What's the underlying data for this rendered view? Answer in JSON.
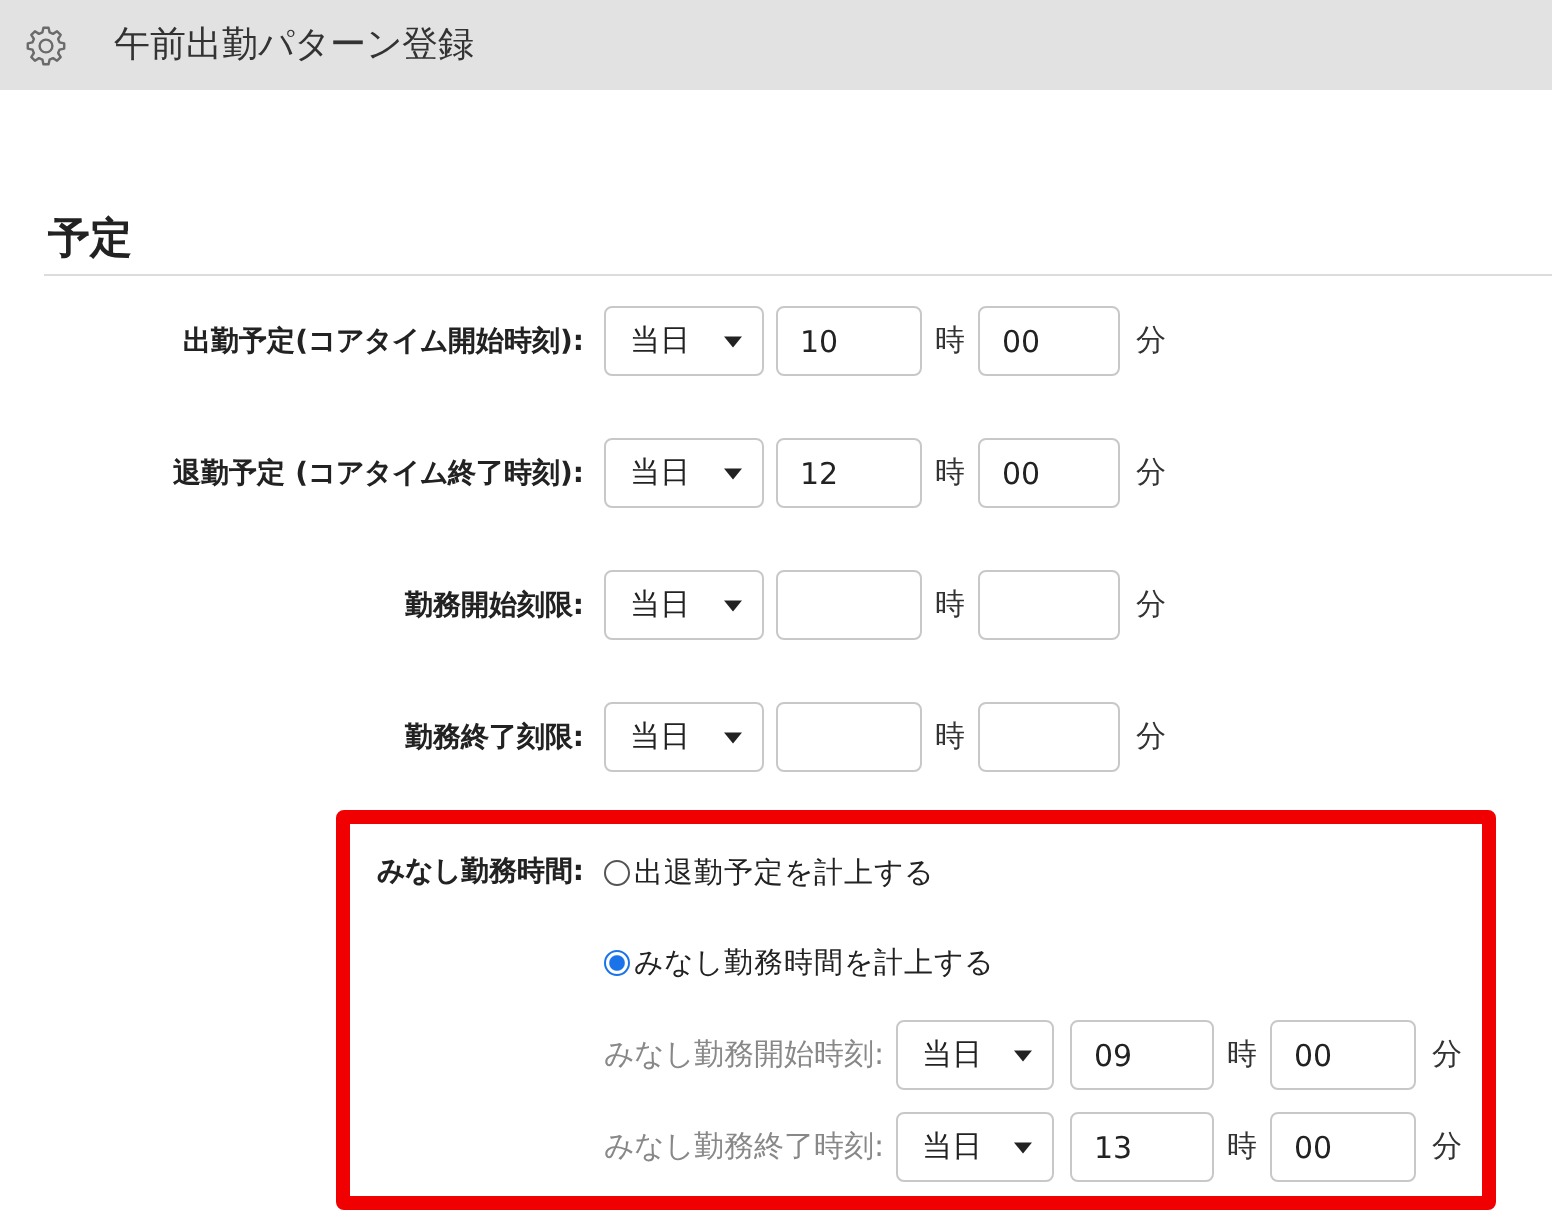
{
  "header": {
    "title": "午前出勤パターン登録"
  },
  "section": {
    "title": "予定"
  },
  "rows": [
    {
      "label": "出勤予定(コアタイム開始時刻):",
      "day": "当日",
      "hour": "10",
      "hour_unit": "時",
      "minute": "00",
      "minute_unit": "分"
    },
    {
      "label": "退勤予定 (コアタイム終了時刻):",
      "day": "当日",
      "hour": "12",
      "hour_unit": "時",
      "minute": "00",
      "minute_unit": "分"
    },
    {
      "label": "勤務開始刻限:",
      "day": "当日",
      "hour_unit": "時",
      "minute_unit": "分"
    },
    {
      "label": "勤務終了刻限:",
      "day": "当日",
      "hour_unit": "時",
      "minute_unit": "分"
    }
  ],
  "deemed_hours": {
    "highlighted": true,
    "label": "みなし勤務時間:",
    "options": [
      {
        "label": "出退勤予定を計上する",
        "selected": false
      },
      {
        "label": "みなし勤務時間を計上する",
        "selected": true
      }
    ],
    "rows": [
      {
        "label": "みなし勤務開始時刻:",
        "day": "当日",
        "hour": "09",
        "hour_unit": "時",
        "minute": "00",
        "minute_unit": "分"
      },
      {
        "label": "みなし勤務終了時刻:",
        "day": "当日",
        "hour": "13",
        "hour_unit": "時",
        "minute": "00",
        "minute_unit": "分"
      }
    ]
  }
}
